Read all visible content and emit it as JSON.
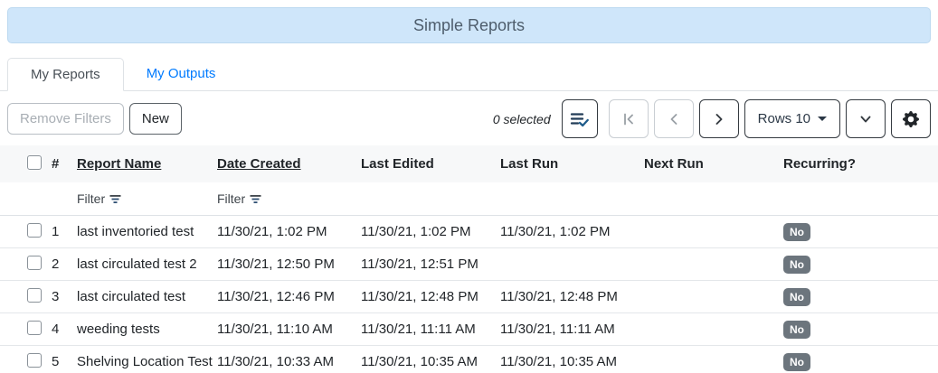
{
  "title_bar": {
    "title": "Simple Reports"
  },
  "tabs": {
    "my_reports": "My Reports",
    "my_outputs": "My Outputs"
  },
  "toolbar": {
    "remove_filters": "Remove Filters",
    "new": "New",
    "selected": "0 selected",
    "rows_per_page": "Rows 10"
  },
  "icons": {
    "multi_select": "list-check-icon",
    "first_page": "first-page-icon",
    "prev_page": "chevron-left-icon",
    "next_page": "chevron-right-icon",
    "rows_caret": "caret-down-icon",
    "expand": "chevron-down-icon",
    "settings": "gear-icon",
    "filter": "filter-lines-icon"
  },
  "table": {
    "headers": {
      "number": "#",
      "report_name": "Report Name",
      "date_created": "Date Created",
      "last_edited": "Last Edited",
      "last_run": "Last Run",
      "next_run": "Next Run",
      "recurring": "Recurring?"
    },
    "filter_label": "Filter",
    "rows": [
      {
        "num": "1",
        "name": "last inventoried test",
        "created": "11/30/21, 1:02 PM",
        "edited": "11/30/21, 1:02 PM",
        "last_run": "11/30/21, 1:02 PM",
        "next_run": "",
        "recurring": "No"
      },
      {
        "num": "2",
        "name": "last circulated test 2",
        "created": "11/30/21, 12:50 PM",
        "edited": "11/30/21, 12:51 PM",
        "last_run": "",
        "next_run": "",
        "recurring": "No"
      },
      {
        "num": "3",
        "name": "last circulated test",
        "created": "11/30/21, 12:46 PM",
        "edited": "11/30/21, 12:48 PM",
        "last_run": "11/30/21, 12:48 PM",
        "next_run": "",
        "recurring": "No"
      },
      {
        "num": "4",
        "name": "weeding tests",
        "created": "11/30/21, 11:10 AM",
        "edited": "11/30/21, 11:11 AM",
        "last_run": "11/30/21, 11:11 AM",
        "next_run": "",
        "recurring": "No"
      },
      {
        "num": "5",
        "name": "Shelving Location Test",
        "created": "11/30/21, 10:33 AM",
        "edited": "11/30/21, 10:35 AM",
        "last_run": "11/30/21, 10:35 AM",
        "next_run": "",
        "recurring": "No"
      }
    ]
  },
  "colors": {
    "title_bg": "#cfe6fa",
    "title_border": "#bcd9f0",
    "title_text": "#4e5d6c",
    "link": "#007bff",
    "tab_text": "#495057",
    "table_border": "#dee2e6",
    "dark": "#343a40",
    "disabled": "#a8aeb4",
    "badge_bg": "#6c757d",
    "header_row_bg": "#f7f8f9",
    "text": "#212529"
  }
}
